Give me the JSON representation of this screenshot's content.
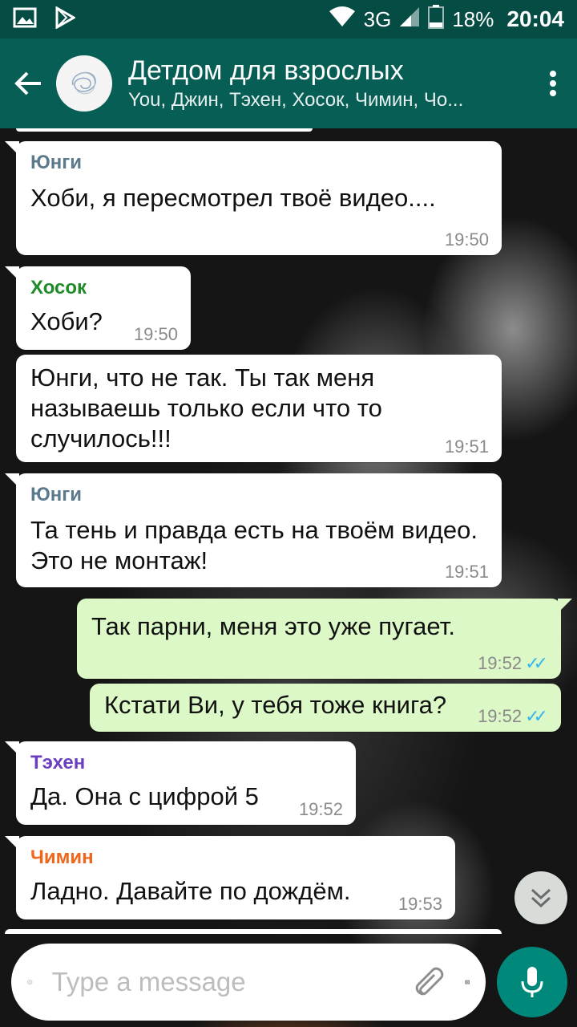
{
  "status_bar": {
    "network": "3G",
    "battery": "18%",
    "time": "20:04"
  },
  "header": {
    "title": "Детдом для взрослых",
    "members": "You, Джин, Тэхен, Хосок, Чимин, Чо..."
  },
  "colors": {
    "header": "#075e54",
    "status_bar": "#054d44",
    "outgoing_bubble": "#dcf8c6",
    "incoming_bubble": "#ffffff",
    "accent": "#00897b",
    "read_ticks": "#34b7f1"
  },
  "messages": [
    {
      "sender": "Юнги",
      "sender_color": "#5b7a8c",
      "text": "Хоби, я пересмотрел твоё видео....",
      "time": "19:50",
      "direction": "in"
    },
    {
      "sender": "Хосок",
      "sender_color": "#1f8a2a",
      "text": "Хоби?",
      "time": "19:50",
      "direction": "in"
    },
    {
      "sender": "",
      "text": "Юнги, что не так. Ты так меня называешь только если что то случилось!!!",
      "time": "19:51",
      "direction": "in"
    },
    {
      "sender": "Юнги",
      "sender_color": "#5b7a8c",
      "text": "Та тень и правда есть на твоём видео. Это не монтаж!",
      "time": "19:51",
      "direction": "in"
    },
    {
      "sender": "",
      "text": "Так парни, меня это уже пугает.",
      "time": "19:52",
      "direction": "out",
      "status": "read"
    },
    {
      "sender": "",
      "text": "Кстати Ви, у тебя тоже книга?",
      "time": "19:52",
      "direction": "out",
      "status": "read"
    },
    {
      "sender": "Тэхен",
      "sender_color": "#6a3fbf",
      "text": "Да. Она с цифрой 5",
      "time": "19:52",
      "direction": "in"
    },
    {
      "sender": "Чимин",
      "sender_color": "#f2661c",
      "text": "Ладно. Давайте по дождём.",
      "time": "19:53",
      "direction": "in"
    }
  ],
  "input": {
    "placeholder": "Type a message"
  },
  "icons": {
    "back": "arrow-left-icon",
    "menu": "more-vert-icon",
    "emoji": "emoji-icon",
    "attach": "paperclip-icon",
    "camera": "camera-icon",
    "mic": "mic-icon",
    "scroll": "chevron-double-down-icon"
  }
}
